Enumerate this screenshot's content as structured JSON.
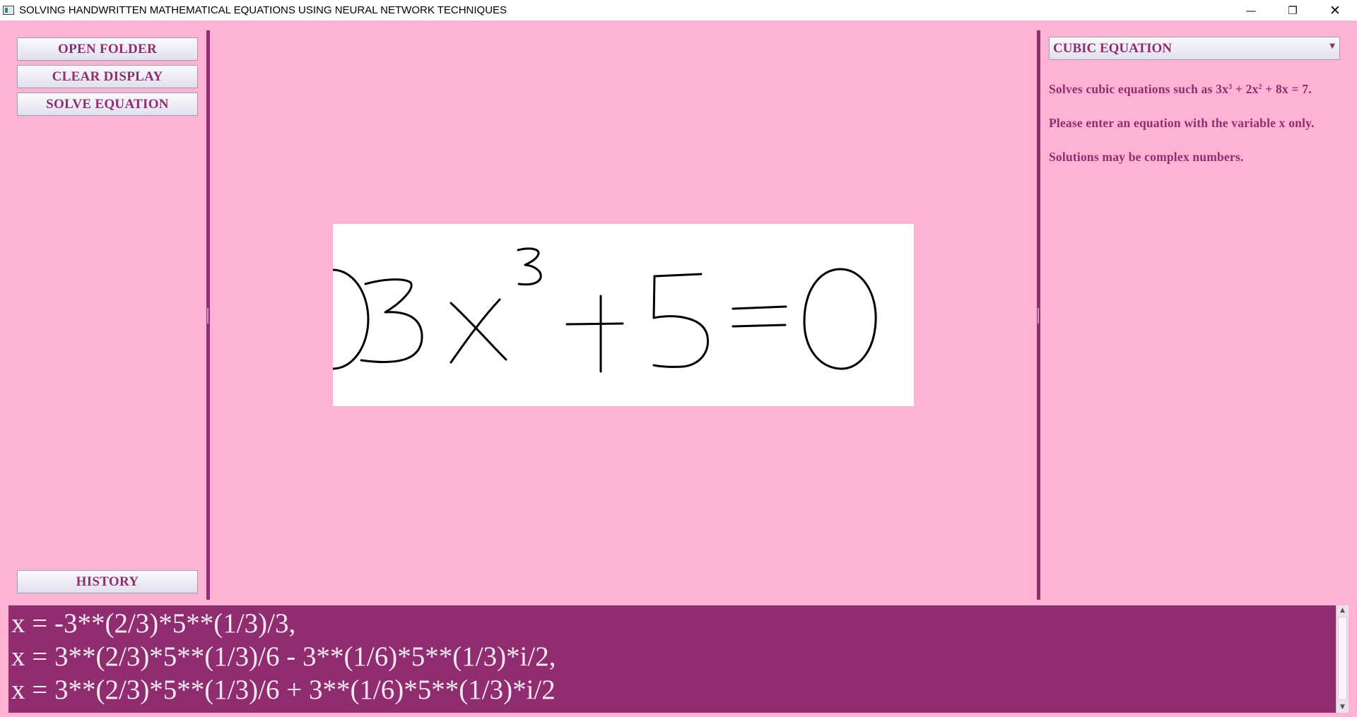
{
  "window": {
    "title": "SOLVING HANDWRITTEN MATHEMATICAL EQUATIONS USING NEURAL NETWORK TECHNIQUES",
    "minimize_glyph": "—",
    "maximize_glyph": "❐",
    "close_glyph": "✕"
  },
  "left_panel": {
    "open_folder": "OPEN FOLDER",
    "clear_display": "CLEAR DISPLAY",
    "solve_equation": "SOLVE EQUATION",
    "history": "HISTORY"
  },
  "canvas": {
    "description_icon": "handwritten-equation",
    "handwritten_equation": "3x^3+5=0"
  },
  "right_panel": {
    "equation_type": "CUBIC EQUATION",
    "dropdown_glyph": "▼",
    "info_line1_prefix": "Solves cubic equations such as 3x",
    "info_line1_exp1": "3",
    "info_line1_mid": " + 2x",
    "info_line1_exp2": "2",
    "info_line1_suffix": " + 8x = 7.",
    "info_line2": "Please enter an equation with the variable x only.",
    "info_line3": "Solutions may be complex numbers."
  },
  "output": {
    "lines": [
      "x = -3**(2/3)*5**(1/3)/3,",
      "x = 3**(2/3)*5**(1/3)/6 - 3**(1/6)*5**(1/3)*i/2,",
      "x = 3**(2/3)*5**(1/3)/6 + 3**(1/6)*5**(1/3)*i/2"
    ]
  },
  "colors": {
    "background": "#ffb3d4",
    "accent": "#8f2d70",
    "output_text": "#f6e9f1"
  }
}
